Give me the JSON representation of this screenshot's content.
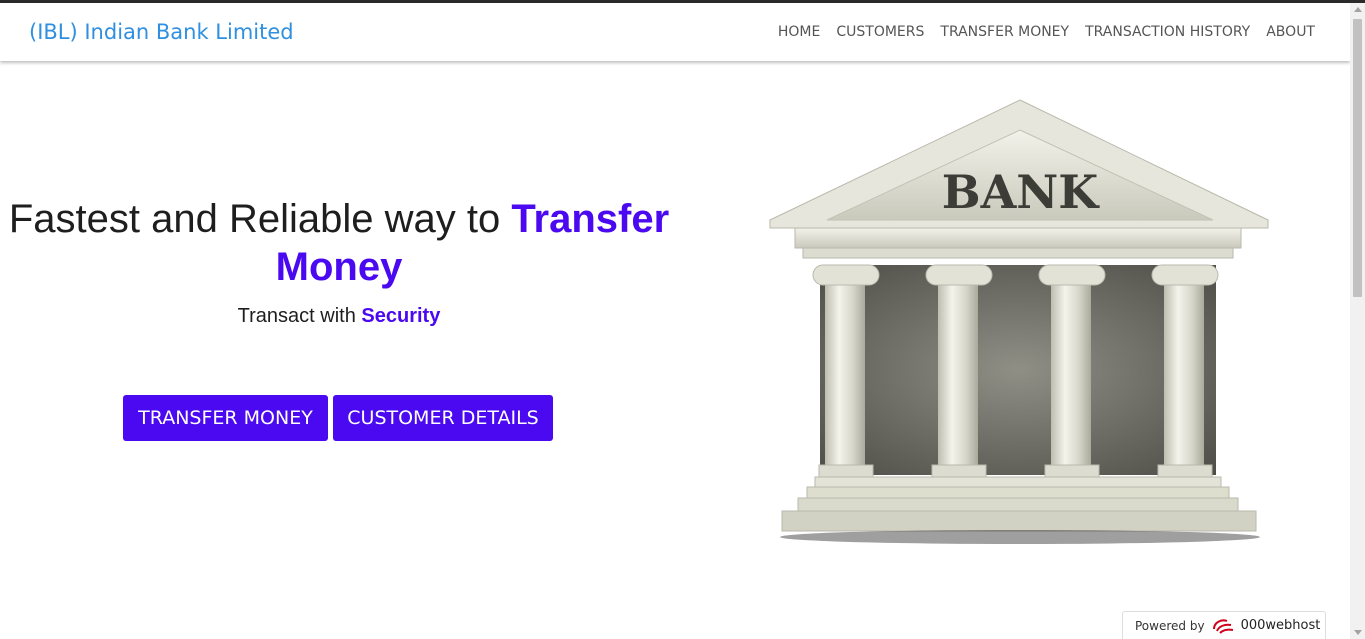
{
  "navbar": {
    "brand": "(IBL) Indian Bank Limited",
    "links": [
      "HOME",
      "CUSTOMERS",
      "TRANSFER MONEY",
      "TRANSACTION HISTORY",
      "ABOUT"
    ]
  },
  "hero": {
    "headline_prefix": "Fastest and Reliable way to ",
    "headline_accent": "Transfer Money",
    "subline_prefix": "Transact with ",
    "subline_accent": "Security"
  },
  "buttons": {
    "transfer": "TRANSFER MONEY",
    "customer": "CUSTOMER DETAILS"
  },
  "illustration": {
    "label": "BANK",
    "icon": "bank-building-icon"
  },
  "footer_badge": {
    "powered_by": "Powered by",
    "provider": "000webhost"
  },
  "colors": {
    "accent": "#4a09f0",
    "brand": "#2f8fe0",
    "nav_text": "#555555"
  }
}
